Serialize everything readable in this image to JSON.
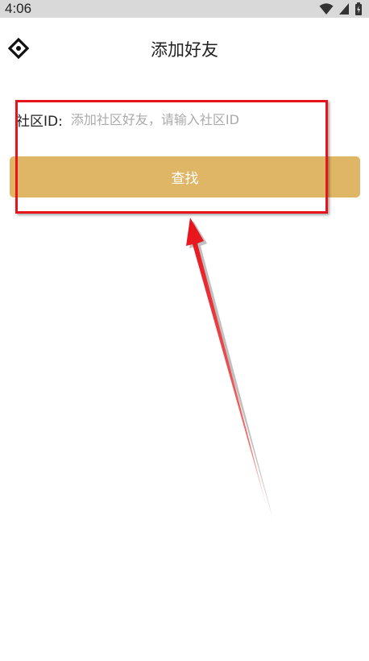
{
  "status_bar": {
    "time": "4:06",
    "icons": [
      "wifi-icon",
      "signal-icon",
      "battery-icon"
    ]
  },
  "header": {
    "back_icon": "diamond-back-icon",
    "title": "添加好友"
  },
  "form": {
    "id_label": "社区ID:",
    "id_value": "",
    "id_placeholder": "添加社区好友，请输入社区ID",
    "search_label": "查找"
  },
  "annotation": {
    "highlight_color": "#e8141b"
  },
  "colors": {
    "button": "#dfb665",
    "status_bar": "#d9d9d9"
  }
}
